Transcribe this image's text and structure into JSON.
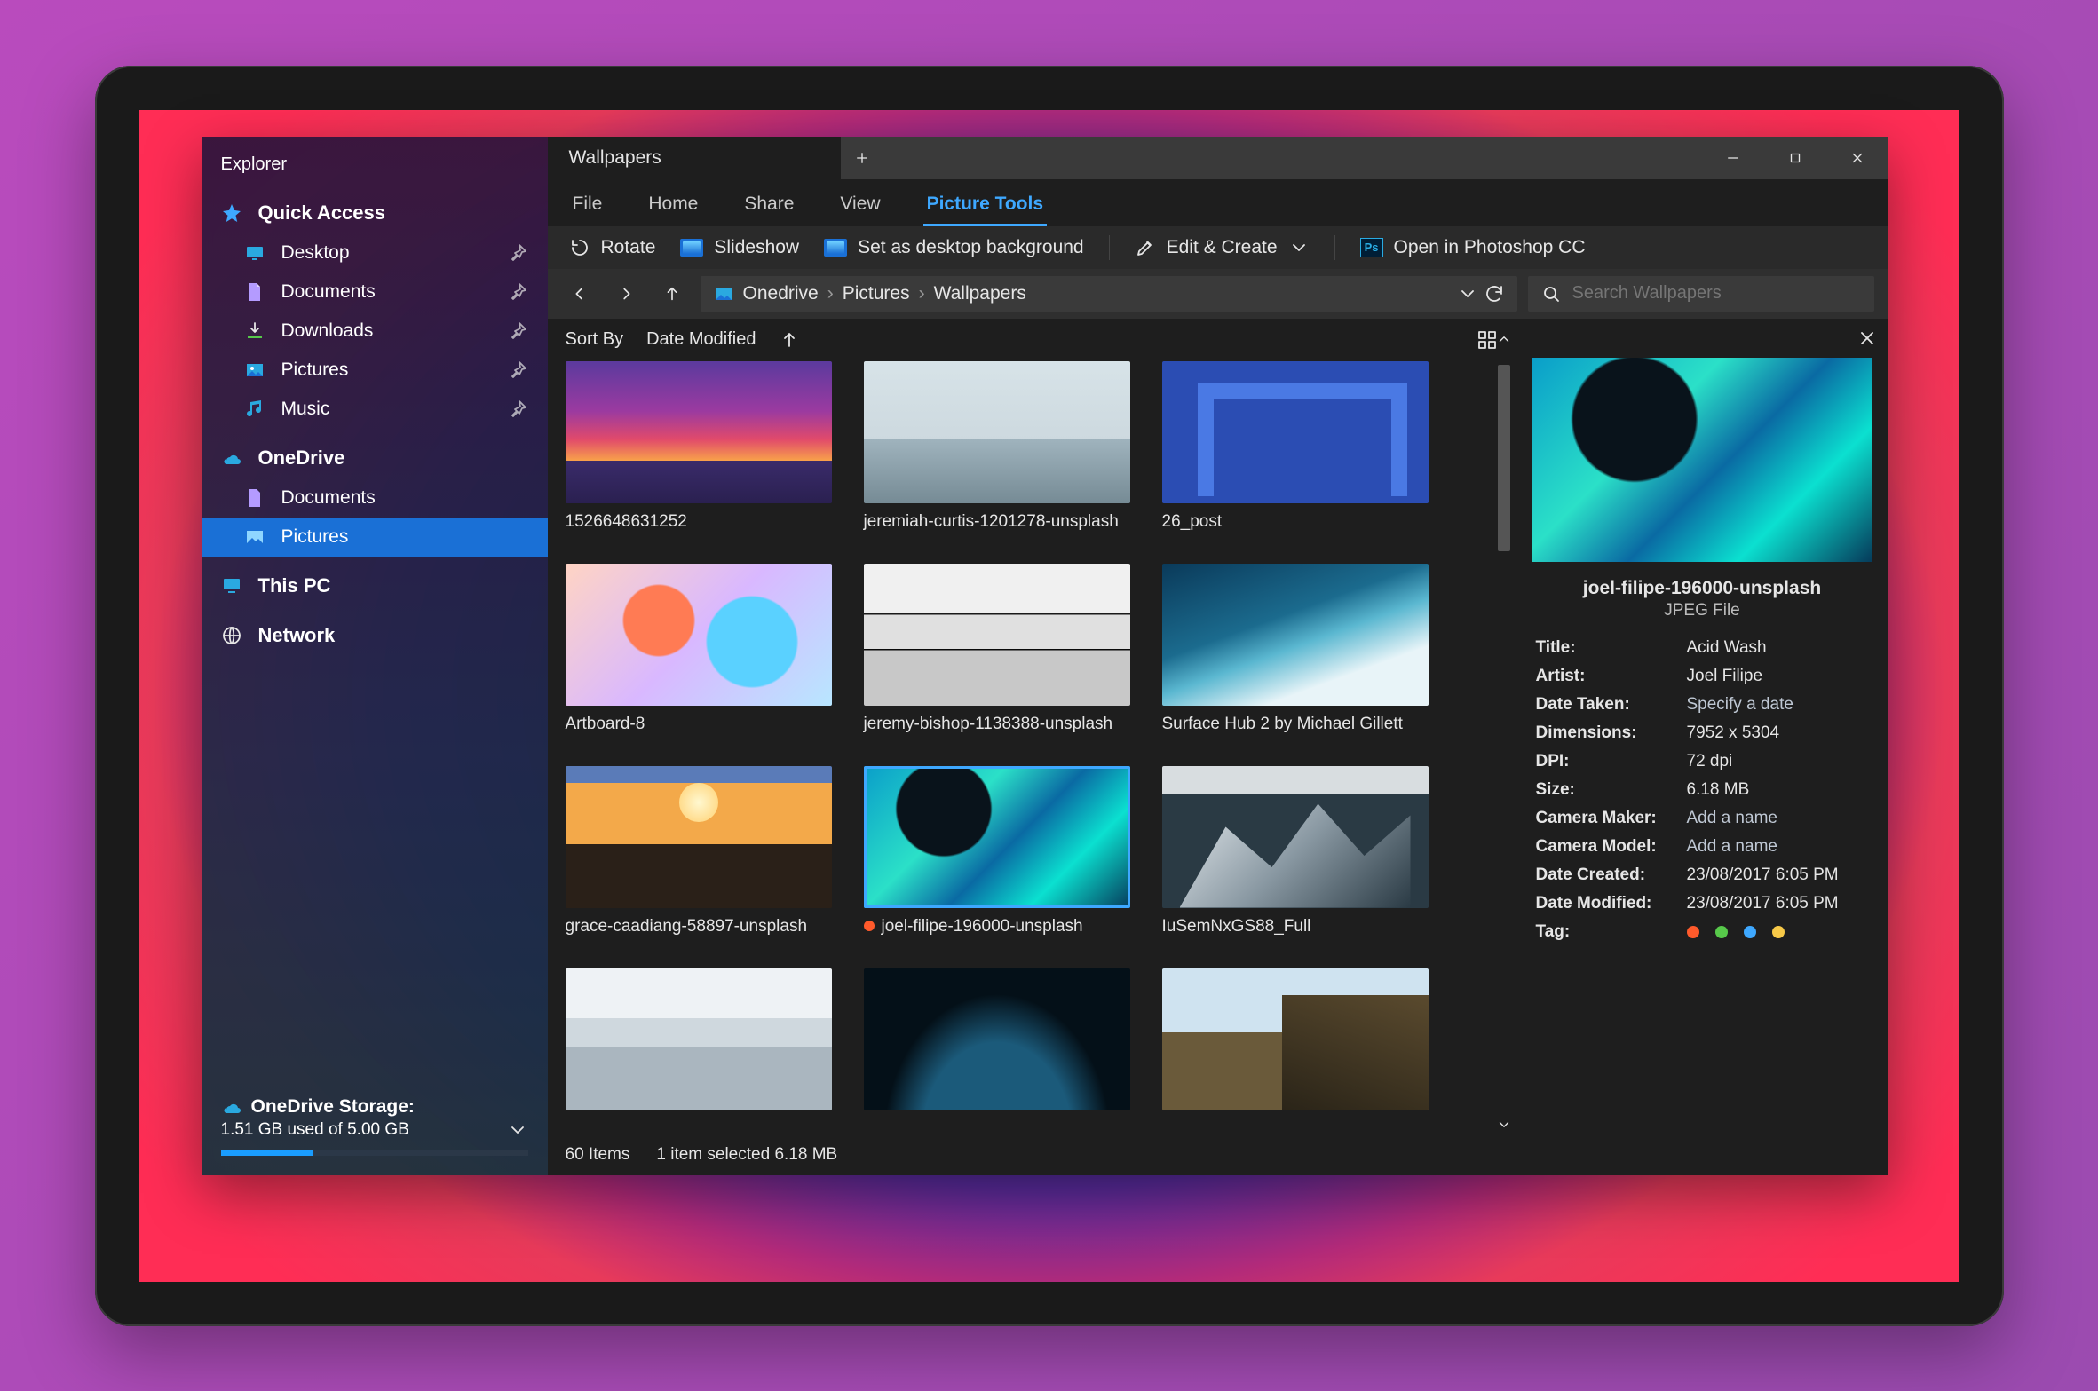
{
  "sidebar": {
    "title": "Explorer",
    "quick_access_label": "Quick Access",
    "items": [
      {
        "label": "Desktop"
      },
      {
        "label": "Documents"
      },
      {
        "label": "Downloads"
      },
      {
        "label": "Pictures"
      },
      {
        "label": "Music"
      }
    ],
    "onedrive_label": "OneDrive",
    "onedrive_items": [
      {
        "label": "Documents"
      },
      {
        "label": "Pictures"
      }
    ],
    "this_pc_label": "This PC",
    "network_label": "Network",
    "storage": {
      "heading": "OneDrive Storage:",
      "summary": "1.51 GB used of 5.00 GB",
      "percent": 30
    }
  },
  "tab": {
    "title": "Wallpapers"
  },
  "ribbon_tabs": {
    "file": "File",
    "home": "Home",
    "share": "Share",
    "view": "View",
    "picture_tools": "Picture Tools"
  },
  "toolbar": {
    "rotate": "Rotate",
    "slideshow": "Slideshow",
    "set_bg": "Set as desktop background",
    "edit_create": "Edit & Create",
    "open_ps": "Open in Photoshop CC"
  },
  "breadcrumb": {
    "root": "Onedrive",
    "mid": "Pictures",
    "leaf": "Wallpapers"
  },
  "search": {
    "placeholder": "Search Wallpapers"
  },
  "sort": {
    "label": "Sort By",
    "value": "Date Modified"
  },
  "files": [
    {
      "name": "1526648631252"
    },
    {
      "name": "jeremiah-curtis-1201278-unsplash"
    },
    {
      "name": "26_post"
    },
    {
      "name": "Artboard-8"
    },
    {
      "name": "jeremy-bishop-1138388-unsplash"
    },
    {
      "name": "Surface Hub 2 by Michael Gillett"
    },
    {
      "name": "grace-caadiang-58897-unsplash"
    },
    {
      "name": "joel-filipe-196000-unsplash",
      "selected": true,
      "dot": true
    },
    {
      "name": "IuSemNxGS88_Full"
    }
  ],
  "status": {
    "count": "60 Items",
    "selection": "1 item selected 6.18 MB"
  },
  "details": {
    "filename": "joel-filipe-196000-unsplash",
    "filetype": "JPEG File",
    "meta": [
      {
        "k": "Title:",
        "v": "Acid Wash"
      },
      {
        "k": "Artist:",
        "v": "Joel Filipe"
      },
      {
        "k": "Date Taken:",
        "v": "Specify a date",
        "link": true
      },
      {
        "k": "Dimensions:",
        "v": "7952 x 5304"
      },
      {
        "k": "DPI:",
        "v": "72 dpi"
      },
      {
        "k": "Size:",
        "v": "6.18 MB"
      },
      {
        "k": "Camera Maker:",
        "v": "Add a name",
        "link": true
      },
      {
        "k": "Camera Model:",
        "v": "Add a name",
        "link": true
      },
      {
        "k": "Date Created:",
        "v": "23/08/2017 6:05 PM"
      },
      {
        "k": "Date Modified:",
        "v": "23/08/2017 6:05 PM"
      }
    ],
    "tag_label": "Tag:"
  }
}
